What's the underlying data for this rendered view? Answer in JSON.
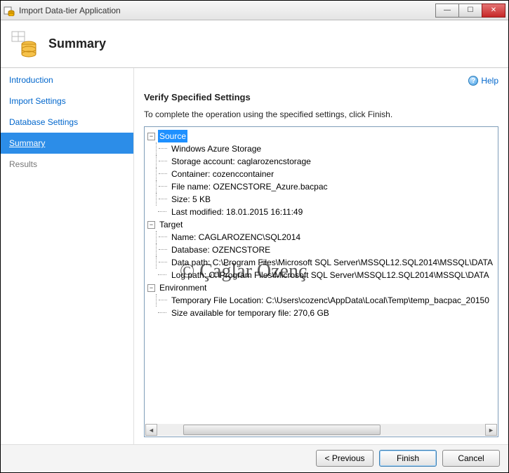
{
  "window": {
    "title": "Import Data-tier Application"
  },
  "header": {
    "title": "Summary"
  },
  "nav": {
    "items": [
      {
        "label": "Introduction"
      },
      {
        "label": "Import Settings"
      },
      {
        "label": "Database Settings"
      },
      {
        "label": "Summary"
      },
      {
        "label": "Results"
      }
    ]
  },
  "help": {
    "label": "Help"
  },
  "content": {
    "section_title": "Verify Specified Settings",
    "instruction": "To complete the operation using the specified settings, click Finish."
  },
  "tree": {
    "source": {
      "label": "Source",
      "items": [
        "Windows Azure Storage",
        "Storage account: caglarozencstorage",
        "Container: cozenccontainer",
        "File name: OZENCSTORE_Azure.bacpac",
        "Size: 5 KB",
        "Last modified: 18.01.2015 16:11:49"
      ]
    },
    "target": {
      "label": "Target",
      "items": [
        "Name: CAGLAROZENC\\SQL2014",
        "Database: OZENCSTORE",
        "Data path: C:\\Program Files\\Microsoft SQL Server\\MSSQL12.SQL2014\\MSSQL\\DATA",
        "Log path: C:\\Program Files\\Microsoft SQL Server\\MSSQL12.SQL2014\\MSSQL\\DATA"
      ]
    },
    "environment": {
      "label": "Environment",
      "items": [
        "Temporary File Location: C:\\Users\\cozenc\\AppData\\Local\\Temp\\temp_bacpac_20150",
        "Size available for temporary file: 270,6 GB"
      ]
    }
  },
  "footer": {
    "previous": "< Previous",
    "finish": "Finish",
    "cancel": "Cancel"
  },
  "watermark": "© Çağlar Özenç"
}
